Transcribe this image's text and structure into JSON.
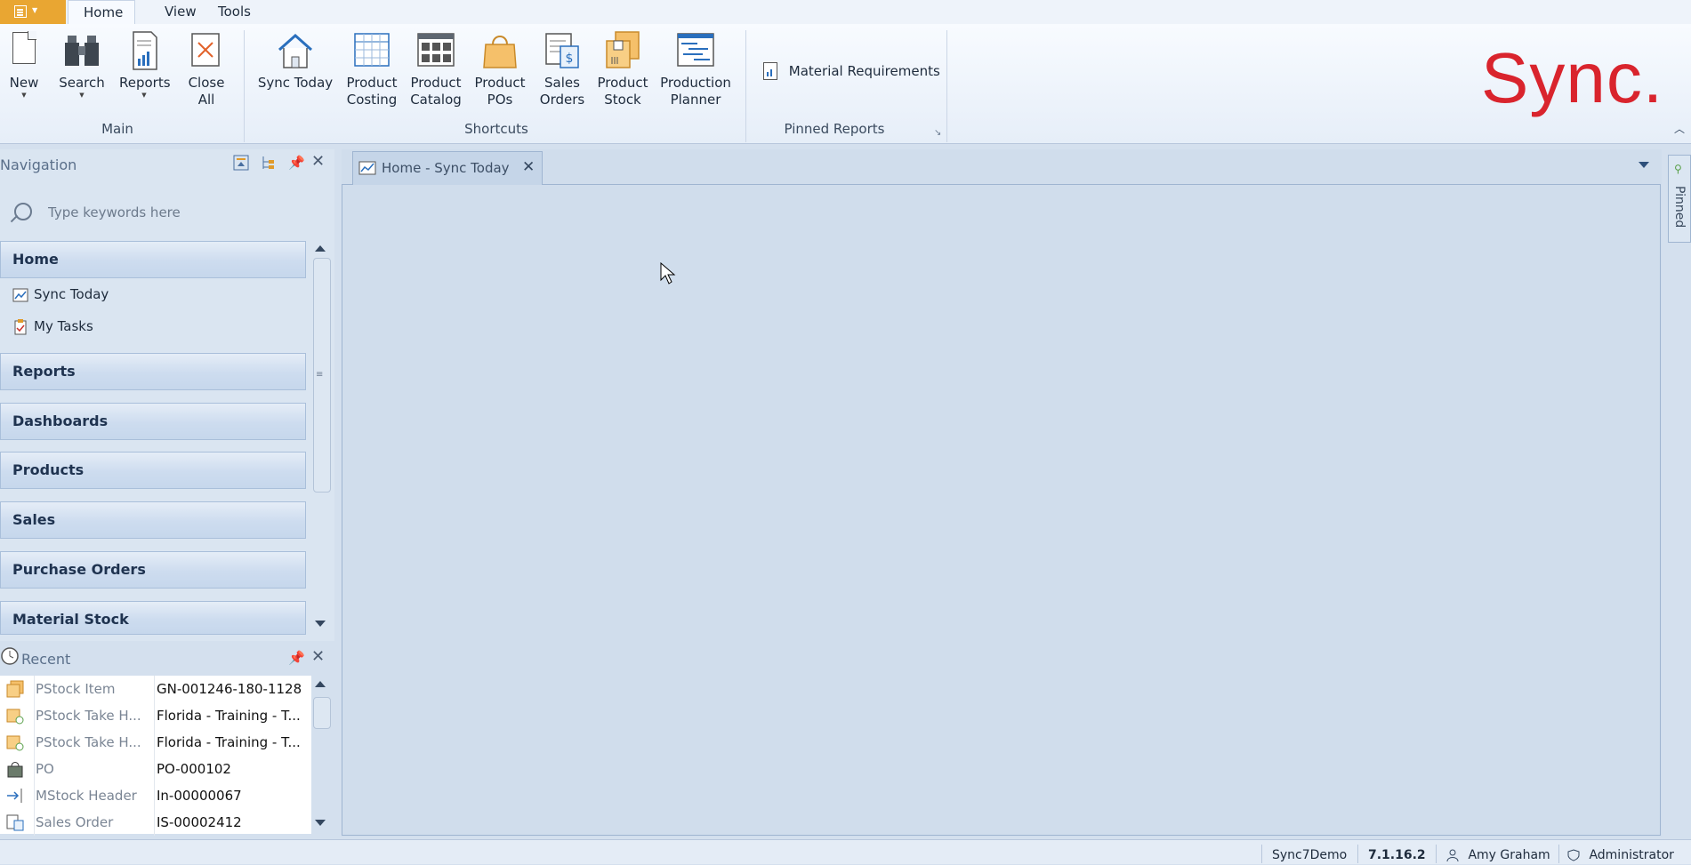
{
  "ribbon": {
    "tabs": [
      "Home",
      "View",
      "Tools"
    ],
    "groups": {
      "main": "Main",
      "shortcuts": "Shortcuts",
      "pinned_reports": "Pinned Reports"
    },
    "main_buttons": [
      {
        "line1": "New",
        "line2": ""
      },
      {
        "line1": "Search",
        "line2": ""
      },
      {
        "line1": "Reports",
        "line2": ""
      },
      {
        "line1": "Close",
        "line2": "All"
      }
    ],
    "shortcut_buttons": [
      {
        "line1": "Sync Today",
        "line2": ""
      },
      {
        "line1": "Product",
        "line2": "Costing"
      },
      {
        "line1": "Product",
        "line2": "Catalog"
      },
      {
        "line1": "Product",
        "line2": "POs"
      },
      {
        "line1": "Sales",
        "line2": "Orders"
      },
      {
        "line1": "Product",
        "line2": "Stock"
      },
      {
        "line1": "Production",
        "line2": "Planner"
      }
    ],
    "pinned_report": "Material Requirements",
    "logo_text": "Sync.",
    "logo_color": "#d9242d"
  },
  "navigation": {
    "title": "Navigation",
    "search_placeholder": "Type keywords here",
    "groups": [
      "Home",
      "Reports",
      "Dashboards",
      "Products",
      "Sales",
      "Purchase Orders",
      "Material Stock"
    ],
    "home_items": [
      "Sync Today",
      "My Tasks"
    ]
  },
  "recent": {
    "title": "Recent",
    "rows": [
      {
        "type": "PStock Item",
        "value": "GN-001246-180-1128"
      },
      {
        "type": "PStock Take H...",
        "value": "Florida - Training - T..."
      },
      {
        "type": "PStock Take H...",
        "value": "Florida - Training - T..."
      },
      {
        "type": "PO",
        "value": "PO-000102"
      },
      {
        "type": "MStock Header",
        "value": "In-00000067"
      },
      {
        "type": "Sales Order",
        "value": "IS-00002412"
      }
    ]
  },
  "document": {
    "tab_title": "Home - Sync Today",
    "pinned_label": "Pinned"
  },
  "status": {
    "database": "Sync7Demo",
    "version": "7.1.16.2",
    "user": "Amy Graham",
    "role": "Administrator"
  }
}
